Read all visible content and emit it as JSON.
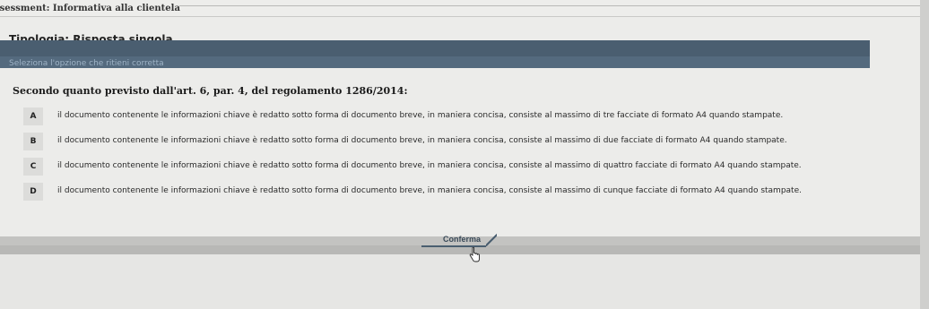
{
  "window": {
    "title": "ssessment: Informativa alla clientela"
  },
  "question_type": "Tipologia: Risposta singola",
  "instruction": "Seleziona l'opzione che ritieni corretta",
  "question_text": "Secondo quanto previsto dall'art. 6, par. 4, del regolamento 1286/2014:",
  "options": [
    {
      "letter": "A",
      "text": "il documento contenente le informazioni chiave è redatto sotto forma di documento breve, in maniera concisa, consiste al massimo di tre facciate di formato A4 quando stampate."
    },
    {
      "letter": "B",
      "text": "il documento contenente le informazioni chiave è redatto sotto forma di documento breve, in maniera concisa, consiste al massimo di due facciate di formato A4 quando stampate."
    },
    {
      "letter": "C",
      "text": "il documento contenente le informazioni chiave è redatto sotto forma di documento breve, in maniera concisa, consiste al massimo di quattro facciate di formato A4 quando stampate."
    },
    {
      "letter": "D",
      "text": "il documento contenente le informazioni chiave è redatto sotto forma di documento breve, in maniera concisa, consiste al massimo di cunque facciate di formato A4 quando stampate."
    }
  ],
  "confirm_button": {
    "label": "Conferma"
  },
  "colors": {
    "background": "#e6e6e4",
    "instruction_bar": "#4a5e70",
    "instruction_text": "#9fb4c7"
  },
  "icons": {
    "cursor": "hand-pointer-icon"
  }
}
